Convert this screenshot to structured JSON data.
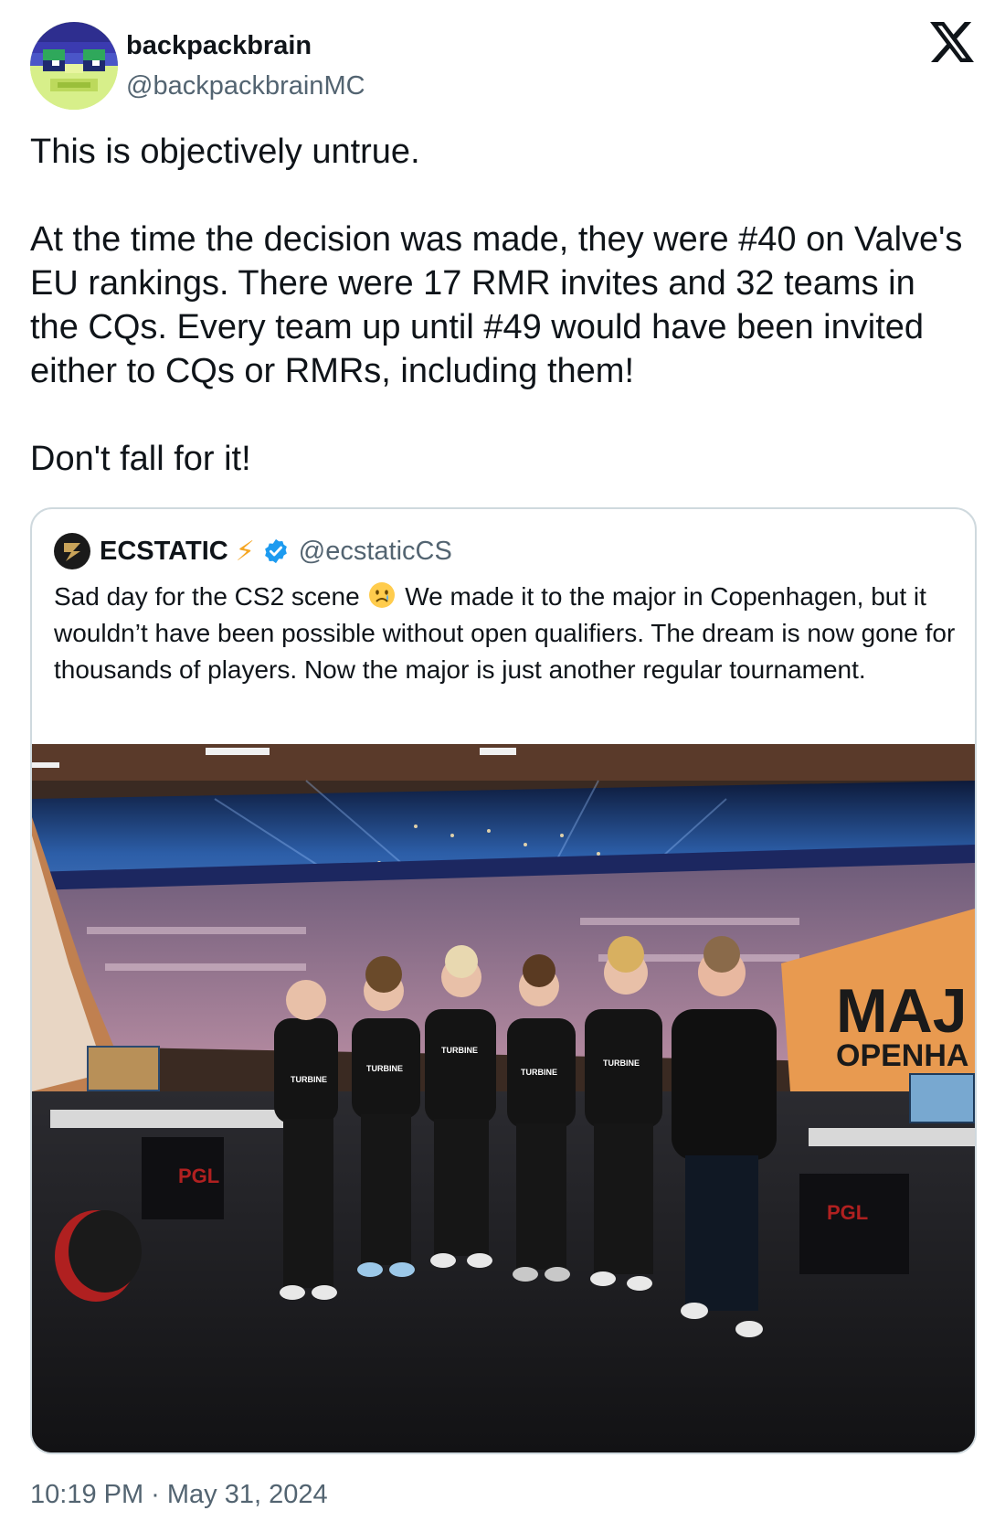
{
  "post": {
    "author_name": "backpackbrain",
    "author_handle": "@backpackbrainMC",
    "text": "This is objectively untrue.\n\nAt the time the decision was made, they were #40 on Valve's EU rankings. There were 17 RMR invites and 32 teams in the CQs. Every team up until #49 would have been invited either to CQs or RMRs, including them!\n\nDon't fall for it!",
    "timestamp": "10:19 PM · May 31, 2024"
  },
  "quoted_post": {
    "author_name": "ECSTATIC",
    "author_emoji": "⚡",
    "author_handle": "@ecstaticCS",
    "text_before_emoji": "Sad day for the CS2 scene ",
    "text_after_emoji": " We made it to the major in Copenhagen, but it wouldn’t have been possible without open qualifiers. The dream is now gone for thousands of players. Now the major is just another regular tournament.",
    "media": {
      "jersey_text": "TURBINE",
      "banner_text_line1": "MAJ",
      "banner_text_line2": "OPENHA",
      "pc_brand": "PGL"
    }
  },
  "icons": {
    "platform": "x-logo",
    "verified": "verified-badge-icon",
    "emoji": "sad-face-emoji"
  },
  "colors": {
    "text_primary": "#0f1419",
    "text_secondary": "#536471",
    "border": "#cfd9de",
    "verified": "#1d9bf0"
  }
}
